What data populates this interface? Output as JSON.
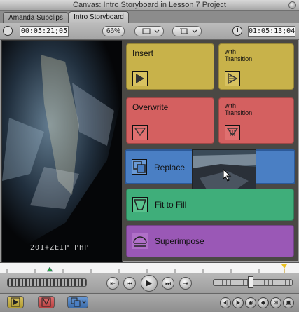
{
  "window": {
    "title": "Canvas: Intro Storyboard in Lesson 7 Project"
  },
  "tabs": [
    {
      "label": "Amanda Subclips",
      "active": false
    },
    {
      "label": "Intro Storyboard",
      "active": true
    }
  ],
  "controls": {
    "duration_timecode": "00:05:21;05",
    "zoom": "66%",
    "current_timecode": "01:05:13;04"
  },
  "overlay": {
    "insert": {
      "label": "Insert",
      "color": "#c8b24a"
    },
    "insert_with_transition": {
      "label": "with\nTransition",
      "color": "#c8b24a"
    },
    "overwrite": {
      "label": "Overwrite",
      "color": "#d46060"
    },
    "overwrite_with_transition": {
      "label": "with\nTransition",
      "color": "#d46060"
    },
    "replace": {
      "label": "Replace",
      "color": "#4a7fc4"
    },
    "fit_to_fill": {
      "label": "Fit to Fill",
      "color": "#3fae7a"
    },
    "superimpose": {
      "label": "Superimpose",
      "color": "#9a58b6"
    }
  },
  "video": {
    "burnin_text": "201+ZEIP PHP"
  }
}
